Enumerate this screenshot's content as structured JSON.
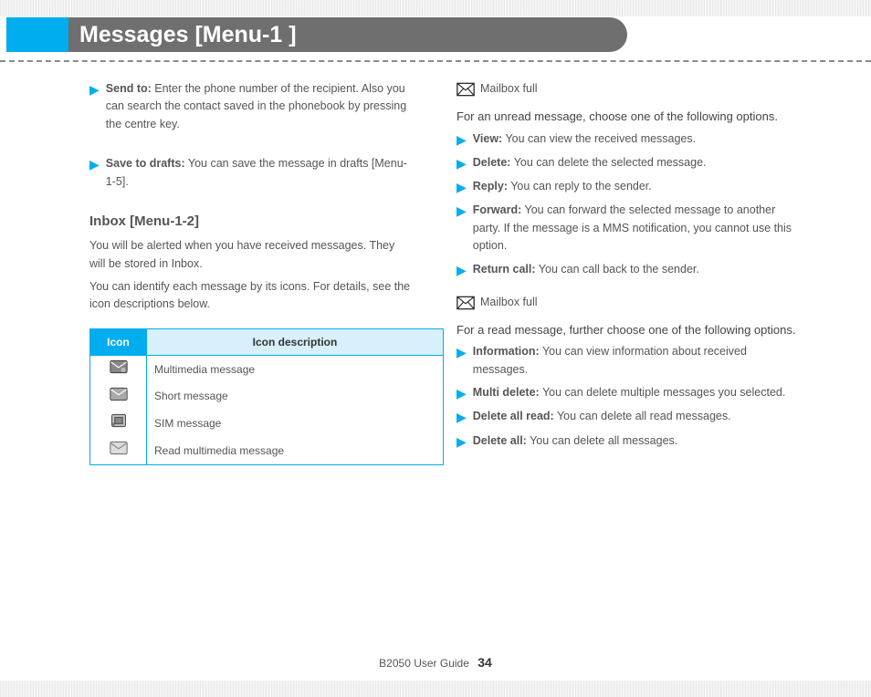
{
  "header": {
    "title": "Messages [Menu-1 ]"
  },
  "left": {
    "bullets": [
      {
        "label": "Send to:",
        "text": "Enter the phone number of the recipient. Also you can search the contact saved in the phonebook by pressing the centre key."
      },
      {
        "label": "Save to drafts:",
        "text": "You can save the message in drafts [Menu-1-5]."
      }
    ],
    "inboxHeading": "Inbox [Menu-1-2]",
    "inboxText1": "You will be alerted when you have received messages. They will be stored in Inbox.",
    "inboxText2": "You can identify each message by its icons. For details, see the icon descriptions below.",
    "table": {
      "col1": "Icon",
      "col2": "Icon description",
      "rows": [
        {
          "icon": "mms-icon",
          "desc": "Multimedia message"
        },
        {
          "icon": "sms-icon",
          "desc": "Short message"
        },
        {
          "icon": "sim-icon",
          "desc": "SIM message"
        },
        {
          "icon": "read-mms-icon",
          "desc": "Read multimedia message"
        }
      ]
    }
  },
  "right": {
    "mailboxIcon": "Mailbox full",
    "unreadHeading": "For an unread message, choose one of the following options.",
    "unreadBullets": [
      {
        "label": "View:",
        "text": "You can view the received messages."
      },
      {
        "label": "Delete:",
        "text": "You can delete the selected message."
      },
      {
        "label": "Reply:",
        "text": "You can reply to the sender."
      },
      {
        "label": "Forward:",
        "text": "You can forward the selected message to another party. If the message is a MMS notification, you cannot use this option."
      },
      {
        "label": "Return call:",
        "text": "You can call back to the sender."
      }
    ],
    "mailboxIcon2": "Mailbox full",
    "readHeading": "For a read message, further choose one of the following options.",
    "readBullets": [
      {
        "label": "Information:",
        "text": "You can view information about received messages."
      },
      {
        "label": "Multi delete:",
        "text": "You can delete multiple messages you selected."
      },
      {
        "label": "Delete all read:",
        "text": "You can delete all read messages."
      },
      {
        "label": "Delete all:",
        "text": "You can delete all messages."
      }
    ]
  },
  "footer": {
    "guide": "B2050 User Guide",
    "page": "34"
  }
}
